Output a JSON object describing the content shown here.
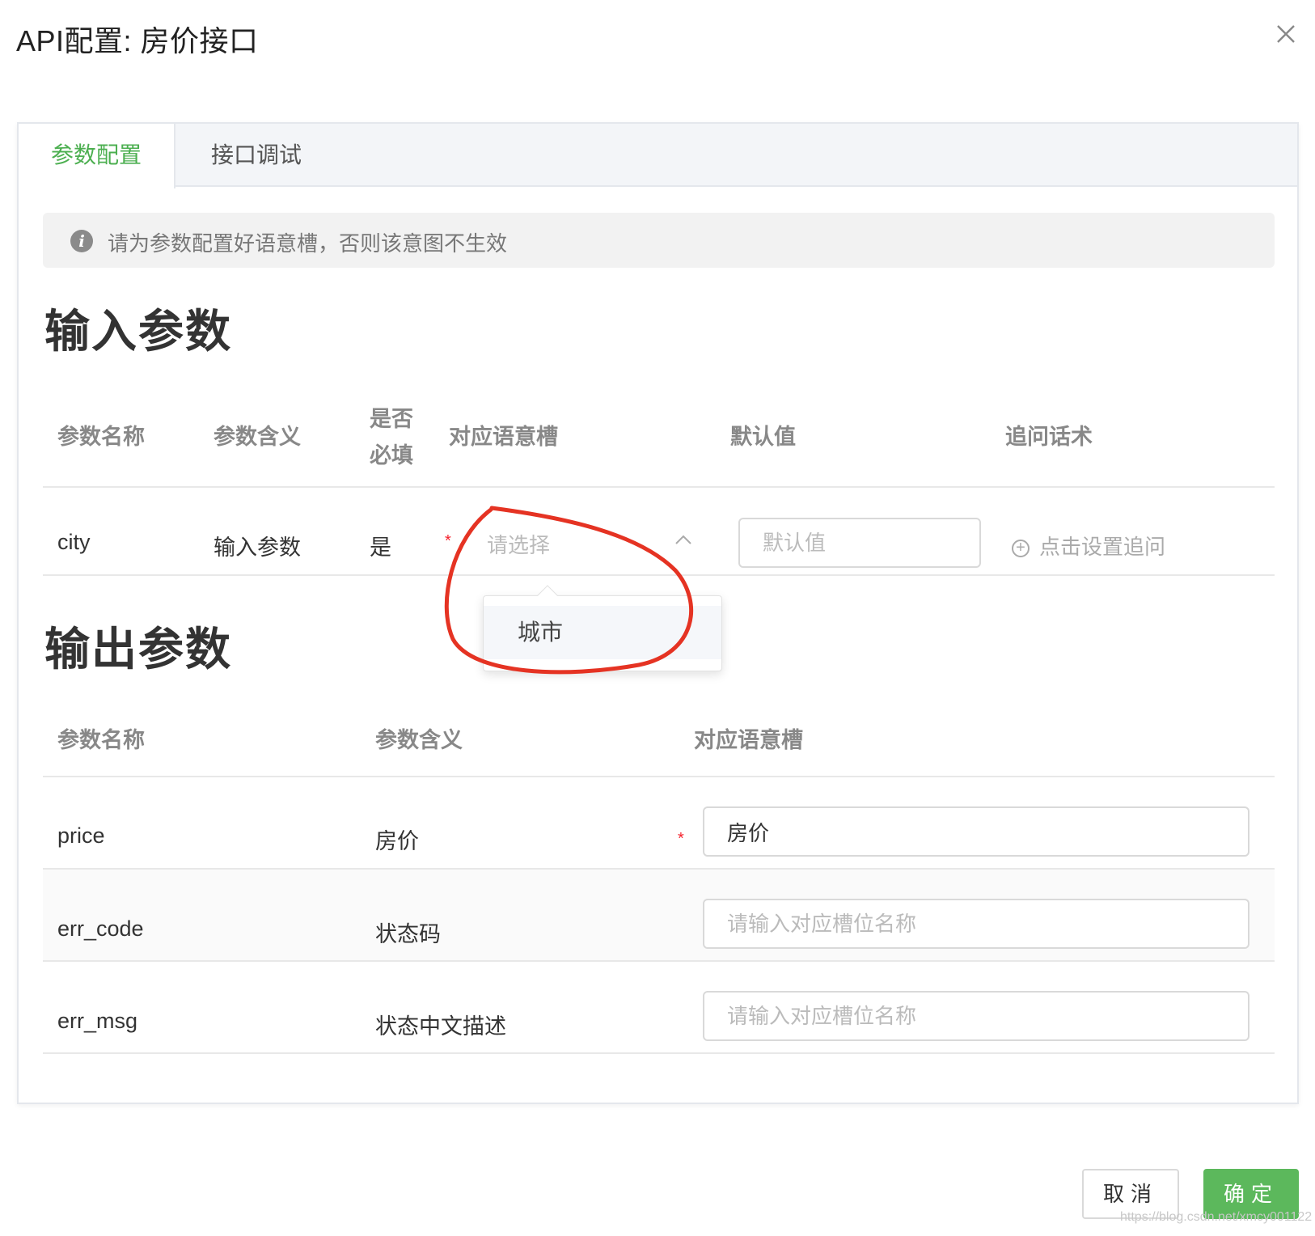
{
  "dialog": {
    "title": "API配置: 房价接口",
    "close_icon": "close-icon"
  },
  "tabs": [
    {
      "label": "参数配置",
      "active": true
    },
    {
      "label": "接口调试",
      "active": false
    }
  ],
  "alert": {
    "icon": "info-icon",
    "text": "请为参数配置好语意槽，否则该意图不生效"
  },
  "input_section": {
    "title": "输入参数",
    "headers": {
      "name": "参数名称",
      "meaning": "参数含义",
      "required_line1": "是否",
      "required_line2": "必填",
      "slot": "对应语意槽",
      "default": "默认值",
      "followup": "追问话术"
    },
    "rows": [
      {
        "name": "city",
        "meaning": "输入参数",
        "required": "是",
        "required_mark": "*",
        "slot_placeholder": "请选择",
        "default_placeholder": "默认值",
        "followup_link": "点击设置追问"
      }
    ],
    "dropdown_options": [
      "城市"
    ]
  },
  "output_section": {
    "title": "输出参数",
    "headers": {
      "name": "参数名称",
      "meaning": "参数含义",
      "slot": "对应语意槽"
    },
    "rows": [
      {
        "name": "price",
        "meaning": "房价",
        "required_mark": "*",
        "slot_value": "房价",
        "slot_placeholder": ""
      },
      {
        "name": "err_code",
        "meaning": "状态码",
        "slot_value": "",
        "slot_placeholder": "请输入对应槽位名称"
      },
      {
        "name": "err_msg",
        "meaning": "状态中文描述",
        "slot_value": "",
        "slot_placeholder": "请输入对应槽位名称"
      }
    ]
  },
  "footer": {
    "cancel": "取消",
    "ok": "确定"
  },
  "watermark": "https://blog.csdn.net/xmcy001122",
  "colors": {
    "accent": "#4caf50",
    "primary_button": "#5cb85c",
    "required": "#f5222d",
    "annotation": "#e53323"
  }
}
